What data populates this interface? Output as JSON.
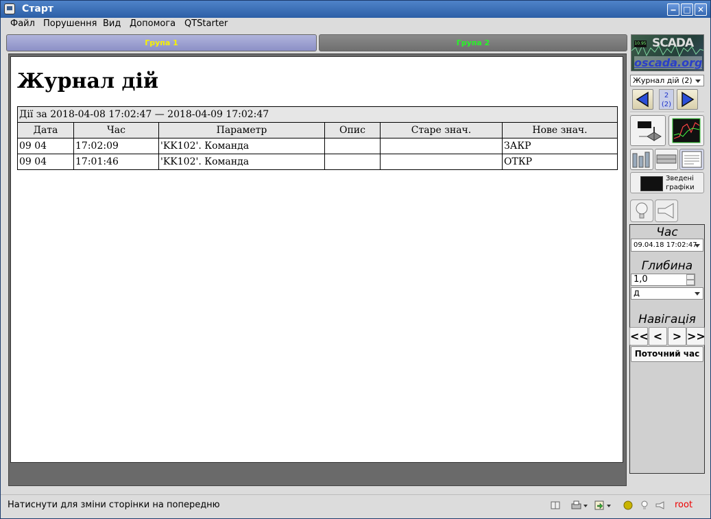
{
  "window": {
    "title": "Старт"
  },
  "titlebar_buttons": {
    "minimize": "‒",
    "maximize": "□",
    "close": "✕"
  },
  "menu": [
    "Файл",
    "Порушення",
    "Вид",
    "Допомога",
    "QTStarter"
  ],
  "tabs": [
    {
      "label": "Група 1",
      "color": "#f7f200",
      "active": true
    },
    {
      "label": "Група 2",
      "color": "#27f527",
      "active": false
    }
  ],
  "document": {
    "heading": "Журнал дій",
    "table_caption": "Дії за 2018-04-08 17:02:47 — 2018-04-09 17:02:47",
    "columns": [
      "Дата",
      "Час",
      "Параметр",
      "Опис",
      "Старе знач.",
      "Нове знач."
    ],
    "rows": [
      [
        "09 04",
        "17:02:09",
        "'KK102'. Команда",
        "",
        "",
        "ЗАКР"
      ],
      [
        "09 04",
        "17:01:46",
        "'KK102'. Команда",
        "",
        "",
        "ОТКР"
      ]
    ]
  },
  "sidebar": {
    "logo_text": "SCADA",
    "logo_site": "oscada.org",
    "page_select": "Журнал дій (2)",
    "page_number": "2",
    "page_total": "(2)",
    "graphs_label_line1": "Зведені",
    "graphs_label_line2": "графіки",
    "time_title": "Час",
    "time_value": "09.04.18 17:02:47",
    "depth_title": "Глибина",
    "depth_value": "1,0",
    "depth_unit": "д",
    "nav_title": "Навігація",
    "nav_buttons": [
      "<<",
      "<",
      ">",
      ">>"
    ],
    "current_time_label": "Поточний час"
  },
  "status": {
    "message": "Натиснути для зміни сторінки на попередню",
    "user": "root"
  }
}
